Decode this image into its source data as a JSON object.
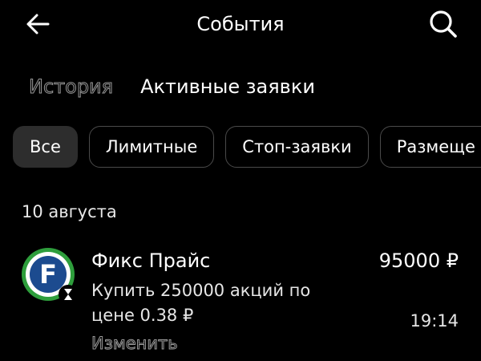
{
  "header": {
    "title": "События",
    "back_icon": "arrow-left-icon",
    "search_icon": "search-icon"
  },
  "tabs": [
    {
      "label": "История",
      "active": false
    },
    {
      "label": "Активные заявки",
      "active": true
    }
  ],
  "filters": [
    {
      "label": "Все",
      "selected": true
    },
    {
      "label": "Лимитные",
      "selected": false
    },
    {
      "label": "Стоп-заявки",
      "selected": false
    },
    {
      "label": "Размеще",
      "selected": false
    }
  ],
  "orders_section": {
    "date": "10 августа",
    "items": [
      {
        "logo_letter": "F",
        "logo_colors": {
          "ring": "#2e9e3c",
          "inner": "#1c4b8f",
          "letter": "#ffffff"
        },
        "status_icon": "hourglass-icon",
        "company": "Фикс Прайс",
        "amount": "95000 ₽",
        "description": "Купить 250000 акций по цене 0.38 ₽",
        "time": "19:14",
        "edit_label": "Изменить"
      }
    ]
  },
  "colors": {
    "background": "#000000",
    "text": "#ffffff",
    "chip_border": "#4a4a4a",
    "chip_selected_bg": "#2d2d2d",
    "muted_outline": "#9a9a9a"
  }
}
